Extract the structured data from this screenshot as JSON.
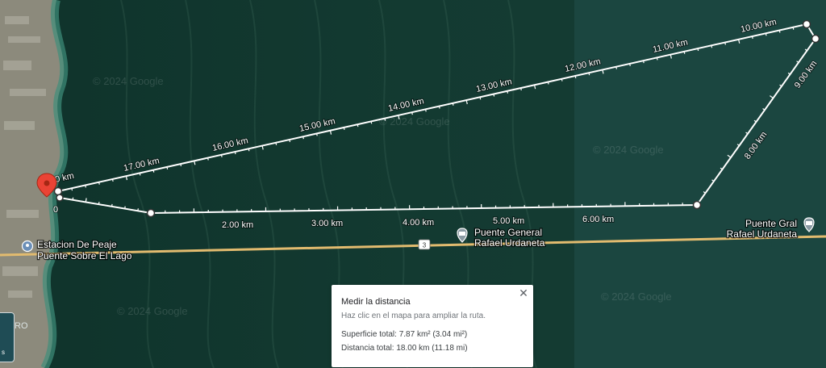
{
  "map": {
    "watermark": "© 2024 Google",
    "water_color": "#12372f",
    "water_color_east": "#1a4440",
    "land_color": "#8f8f84",
    "route_color": "#ffffff",
    "road_color": "#e7c27a",
    "pin_color": "#ea4335",
    "places": [
      {
        "name": "toll-station",
        "icon": "pin-icon",
        "lines": [
          "Estacion De Peaje",
          "Puente Sobre El Lago"
        ]
      },
      {
        "name": "bridge-center",
        "icon": "bridge-icon",
        "lines": [
          "Puente General",
          "Rafael Urdaneta"
        ]
      },
      {
        "name": "bridge-east",
        "icon": "bridge-icon",
        "lines": [
          "Puente Gral",
          "Rafael Urdaneta"
        ]
      }
    ],
    "road_shield": "3",
    "side_label": "RO",
    "side_chip_label": "s"
  },
  "measure": {
    "start_label": "0",
    "top_origin_label": "0 km",
    "top_labels": [
      "17.00 km",
      "16.00 km",
      "15.00 km",
      "14.00 km",
      "13.00 km",
      "12.00 km",
      "11.00 km",
      "10.00 km"
    ],
    "right_labels": [
      "9.00 km",
      "8.00 km"
    ],
    "bottom_labels": [
      "2.00 km",
      "3.00 km",
      "4.00 km",
      "5.00 km",
      "6.00 km"
    ]
  },
  "card": {
    "title": "Medir la distancia",
    "hint": "Haz clic en el mapa para ampliar la ruta.",
    "area": "Superficie total: 7.87 km² (3.04 mi²)",
    "distance": "Distancia total: 18.00 km (11.18 mi)",
    "close_icon": "close-icon"
  }
}
